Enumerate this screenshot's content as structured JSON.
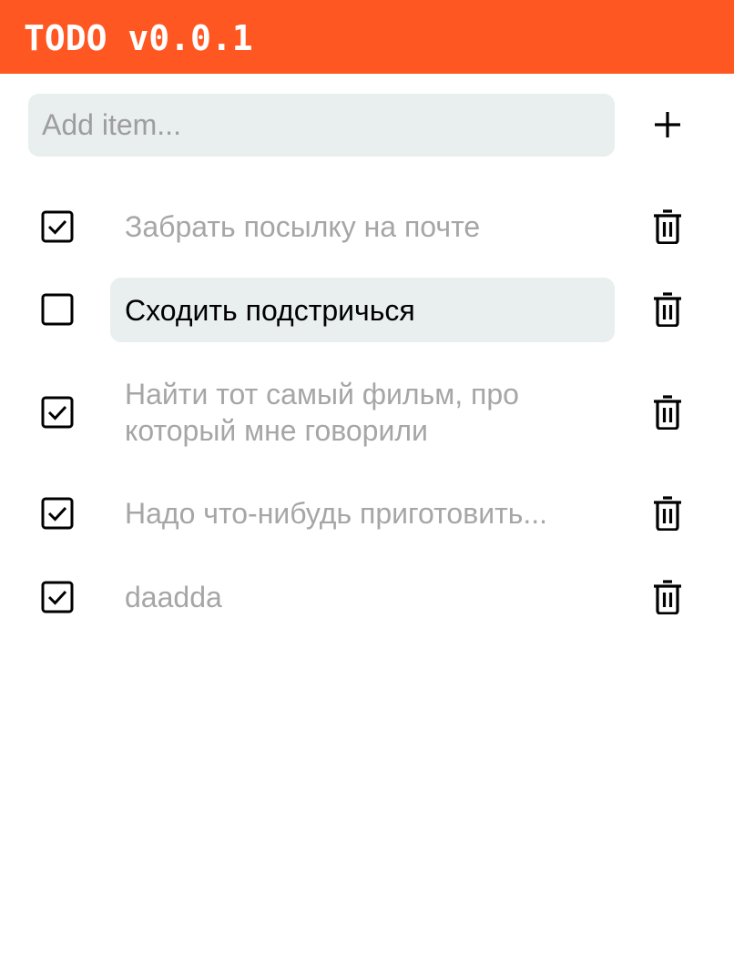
{
  "app": {
    "title": "TODO v0.0.1",
    "header_color": "#ff5722"
  },
  "add_form": {
    "placeholder": "Add item...",
    "value": "",
    "add_icon": "plus-icon"
  },
  "todos": [
    {
      "text": "Забрать посылку на почте",
      "checked": true
    },
    {
      "text": "Сходить подстричься",
      "checked": false
    },
    {
      "text": "Найти тот самый фильм, про который мне говорили",
      "checked": true
    },
    {
      "text": "Надо что-нибудь приготовить...",
      "checked": true
    },
    {
      "text": "daadda",
      "checked": true
    }
  ],
  "icons": {
    "checked": "checkbox-checked-icon",
    "unchecked": "checkbox-empty-icon",
    "delete": "trash-icon"
  },
  "colors": {
    "done_text": "#a6a6a6",
    "active_text": "#000000",
    "field_bg": "#e9eeee"
  }
}
